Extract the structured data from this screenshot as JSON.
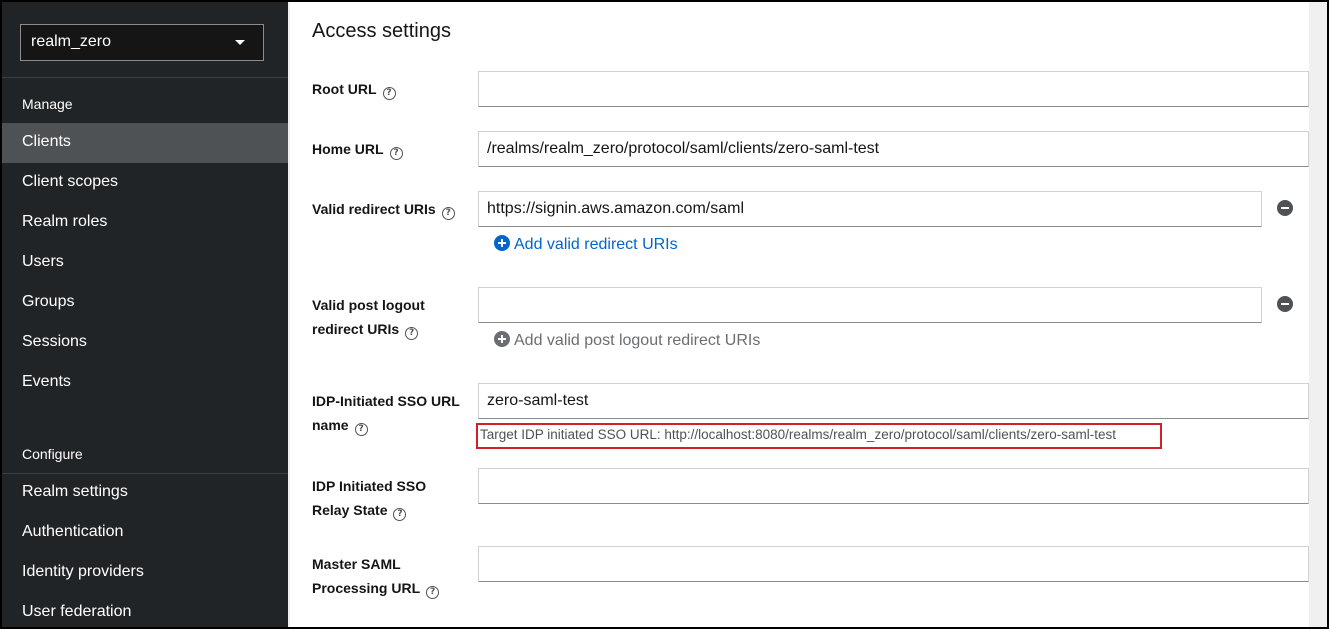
{
  "sidebar": {
    "realm": "realm_zero",
    "manage_title": "Manage",
    "manage_items": [
      "Clients",
      "Client scopes",
      "Realm roles",
      "Users",
      "Groups",
      "Sessions",
      "Events"
    ],
    "configure_title": "Configure",
    "configure_items": [
      "Realm settings",
      "Authentication",
      "Identity providers",
      "User federation"
    ],
    "active_item": "Clients"
  },
  "main": {
    "heading": "Access settings",
    "fields": {
      "root_url": {
        "label": "Root URL",
        "value": ""
      },
      "home_url": {
        "label": "Home URL",
        "value": "/realms/realm_zero/protocol/saml/clients/zero-saml-test"
      },
      "valid_redirect": {
        "label": "Valid redirect URIs",
        "value": "https://signin.aws.amazon.com/saml",
        "add_label": "Add valid redirect URIs"
      },
      "post_logout": {
        "label_line1": "Valid post logout",
        "label_line2": "redirect URIs",
        "value": "",
        "add_label": "Add valid post logout redirect URIs"
      },
      "idp_sso_name": {
        "label_line1": "IDP-Initiated SSO URL",
        "label_line2": "name",
        "value": "zero-saml-test",
        "helper": "Target IDP initiated SSO URL: http://localhost:8080/realms/realm_zero/protocol/saml/clients/zero-saml-test"
      },
      "relay_state": {
        "label_line1": "IDP Initiated SSO",
        "label_line2": "Relay State",
        "value": ""
      },
      "master_saml": {
        "label_line1": "Master SAML",
        "label_line2": "Processing URL",
        "value": ""
      }
    }
  },
  "colors": {
    "sidebar_bg": "#212427",
    "active_bg": "#4f5255",
    "link": "#0066cc",
    "highlight": "#d0212b"
  }
}
